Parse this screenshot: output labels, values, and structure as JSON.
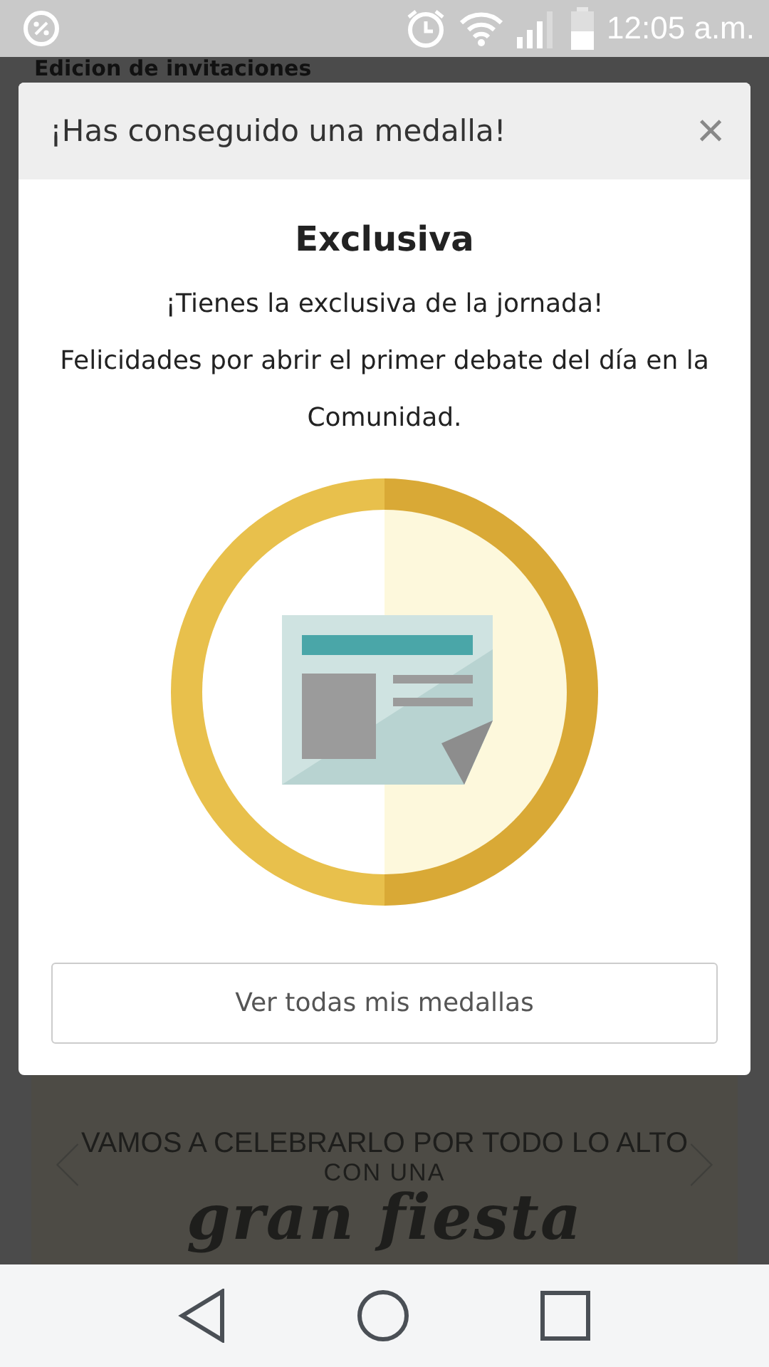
{
  "status_bar": {
    "time": "12:05 a.m."
  },
  "background_page": {
    "title": "Edicion de invitaciones",
    "invitation": {
      "lines": [
        "VAMOS A CELEBRARLO POR TODO LO ALTO",
        "CON UNA",
        "gran fiesta"
      ]
    }
  },
  "dialog": {
    "header": "¡Has conseguido una medalla!",
    "close": "×",
    "title": "Exclusiva",
    "message": [
      "¡Tienes la exclusiva de la jornada!",
      "Felicidades por abrir el primer debate del día en la Comunidad."
    ],
    "button": "Ver todas mis medallas"
  }
}
